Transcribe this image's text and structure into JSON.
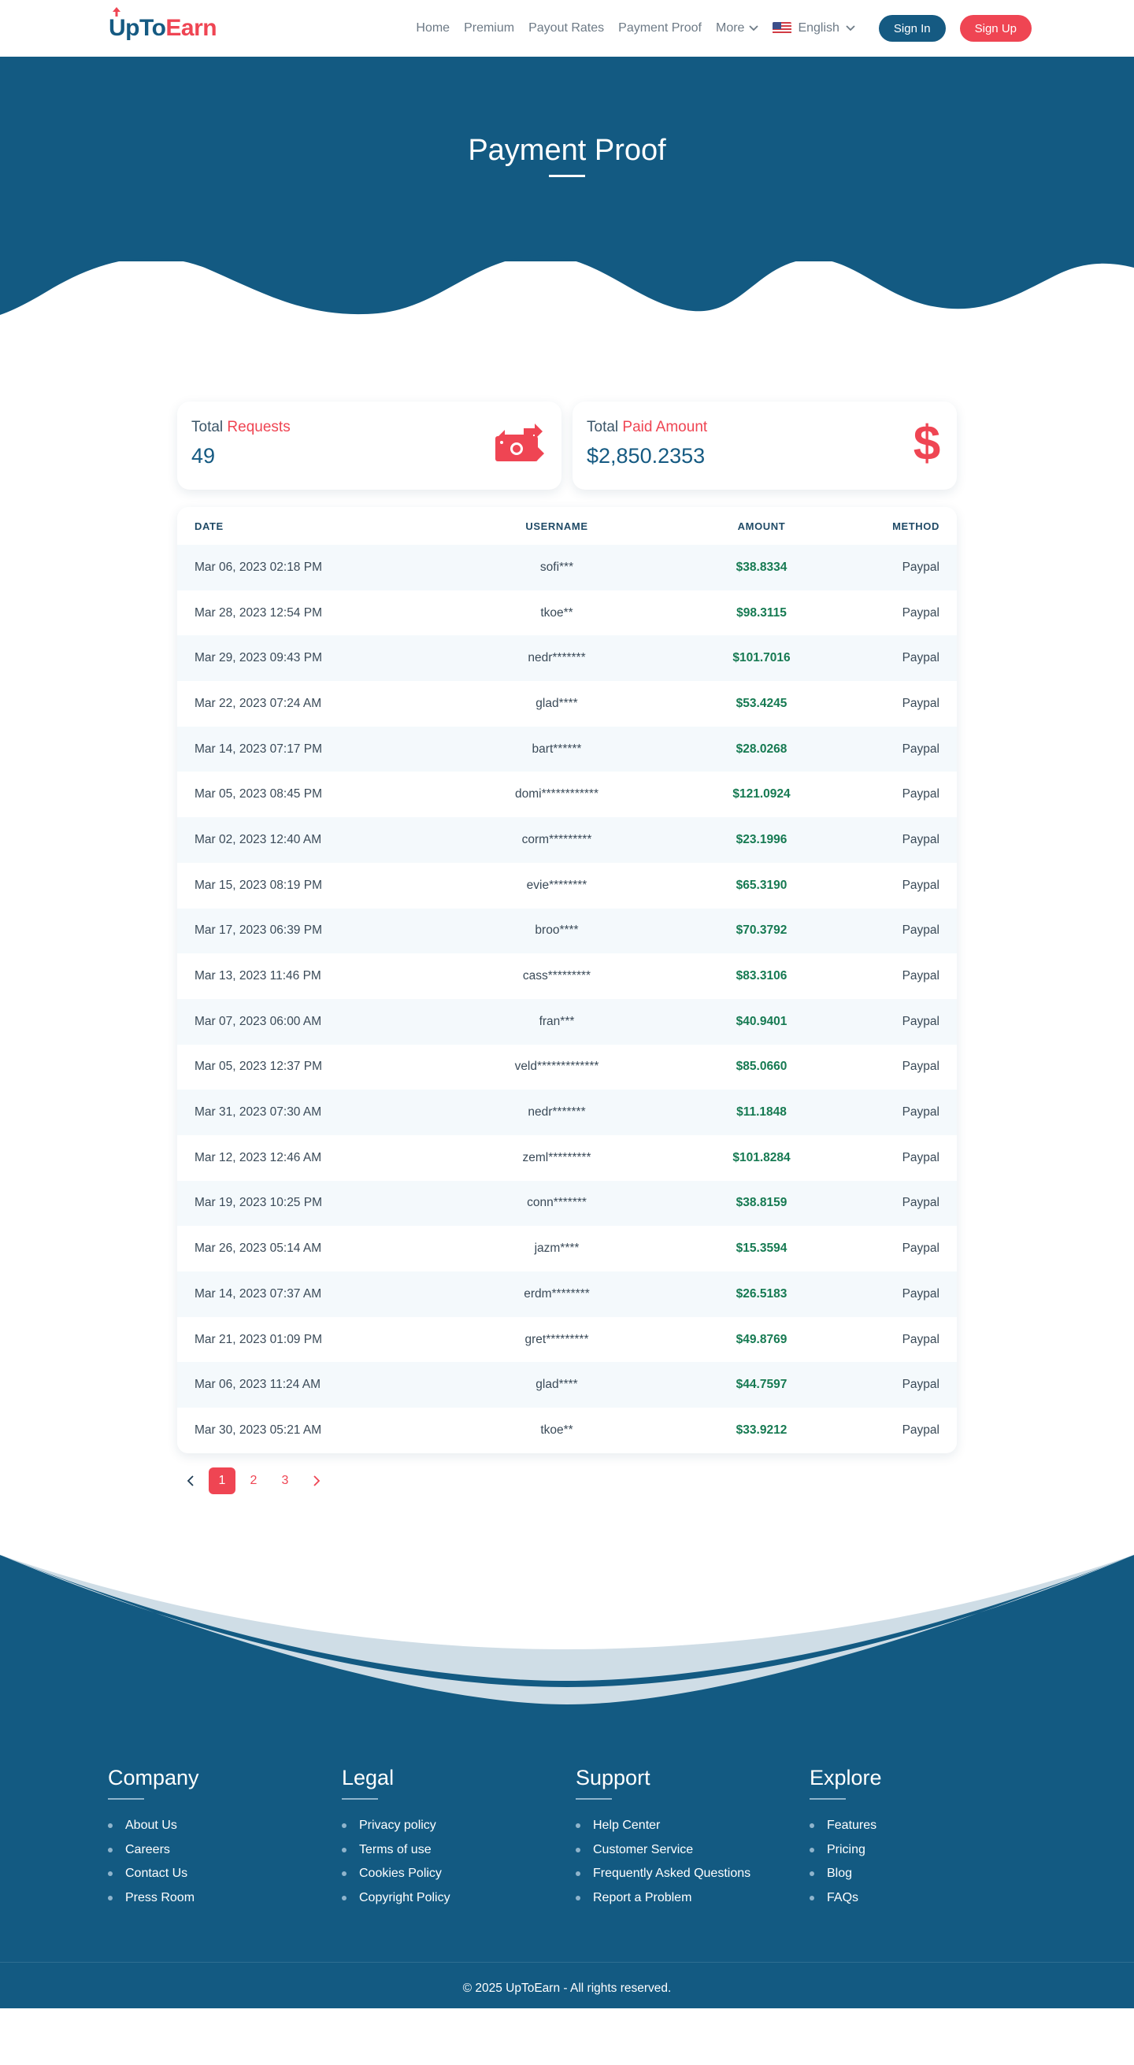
{
  "nav": {
    "logo_up": "UpTo",
    "logo_earn": "Earn",
    "links": [
      "Home",
      "Premium",
      "Payout Rates",
      "Payment Proof"
    ],
    "more": "More",
    "language": "English",
    "signin": "Sign In",
    "signup": "Sign Up"
  },
  "hero": {
    "title": "Payment Proof"
  },
  "stats": {
    "requests": {
      "label_plain": "Total",
      "label_accent": "Requests",
      "value": "49",
      "icon": "money-exchange-icon"
    },
    "paid": {
      "label_plain": "Total",
      "label_accent": "Paid Amount",
      "value": "$2,850.2353",
      "icon": "dollar-icon"
    }
  },
  "table": {
    "headers": {
      "date": "DATE",
      "username": "USERNAME",
      "amount": "AMOUNT",
      "method": "METHOD"
    },
    "rows": [
      {
        "date": "Mar 06, 2023 02:18 PM",
        "username": "sofi***",
        "amount": "$38.8334",
        "method": "Paypal"
      },
      {
        "date": "Mar 28, 2023 12:54 PM",
        "username": "tkoe**",
        "amount": "$98.3115",
        "method": "Paypal"
      },
      {
        "date": "Mar 29, 2023 09:43 PM",
        "username": "nedr*******",
        "amount": "$101.7016",
        "method": "Paypal"
      },
      {
        "date": "Mar 22, 2023 07:24 AM",
        "username": "glad****",
        "amount": "$53.4245",
        "method": "Paypal"
      },
      {
        "date": "Mar 14, 2023 07:17 PM",
        "username": "bart******",
        "amount": "$28.0268",
        "method": "Paypal"
      },
      {
        "date": "Mar 05, 2023 08:45 PM",
        "username": "domi************",
        "amount": "$121.0924",
        "method": "Paypal"
      },
      {
        "date": "Mar 02, 2023 12:40 AM",
        "username": "corm*********",
        "amount": "$23.1996",
        "method": "Paypal"
      },
      {
        "date": "Mar 15, 2023 08:19 PM",
        "username": "evie********",
        "amount": "$65.3190",
        "method": "Paypal"
      },
      {
        "date": "Mar 17, 2023 06:39 PM",
        "username": "broo****",
        "amount": "$70.3792",
        "method": "Paypal"
      },
      {
        "date": "Mar 13, 2023 11:46 PM",
        "username": "cass*********",
        "amount": "$83.3106",
        "method": "Paypal"
      },
      {
        "date": "Mar 07, 2023 06:00 AM",
        "username": "fran***",
        "amount": "$40.9401",
        "method": "Paypal"
      },
      {
        "date": "Mar 05, 2023 12:37 PM",
        "username": "veld*************",
        "amount": "$85.0660",
        "method": "Paypal"
      },
      {
        "date": "Mar 31, 2023 07:30 AM",
        "username": "nedr*******",
        "amount": "$11.1848",
        "method": "Paypal"
      },
      {
        "date": "Mar 12, 2023 12:46 AM",
        "username": "zeml*********",
        "amount": "$101.8284",
        "method": "Paypal"
      },
      {
        "date": "Mar 19, 2023 10:25 PM",
        "username": "conn*******",
        "amount": "$38.8159",
        "method": "Paypal"
      },
      {
        "date": "Mar 26, 2023 05:14 AM",
        "username": "jazm****",
        "amount": "$15.3594",
        "method": "Paypal"
      },
      {
        "date": "Mar 14, 2023 07:37 AM",
        "username": "erdm********",
        "amount": "$26.5183",
        "method": "Paypal"
      },
      {
        "date": "Mar 21, 2023 01:09 PM",
        "username": "gret*********",
        "amount": "$49.8769",
        "method": "Paypal"
      },
      {
        "date": "Mar 06, 2023 11:24 AM",
        "username": "glad****",
        "amount": "$44.7597",
        "method": "Paypal"
      },
      {
        "date": "Mar 30, 2023 05:21 AM",
        "username": "tkoe**",
        "amount": "$33.9212",
        "method": "Paypal"
      }
    ]
  },
  "pagination": {
    "pages": [
      "1",
      "2",
      "3"
    ],
    "current": "1"
  },
  "footer": {
    "columns": [
      {
        "title": "Company",
        "items": [
          "About Us",
          "Careers",
          "Contact Us",
          "Press Room"
        ]
      },
      {
        "title": "Legal",
        "items": [
          "Privacy policy",
          "Terms of use",
          "Cookies Policy",
          "Copyright Policy"
        ]
      },
      {
        "title": "Support",
        "items": [
          "Help Center",
          "Customer Service",
          "Frequently Asked Questions",
          "Report a Problem"
        ]
      },
      {
        "title": "Explore",
        "items": [
          "Features",
          "Pricing",
          "Blog",
          "FAQs"
        ]
      }
    ],
    "copyright": "© 2025 UpToEarn - All rights reserved."
  },
  "colors": {
    "primary": "#135a82",
    "accent": "#ef4553",
    "amount": "#167a52"
  }
}
